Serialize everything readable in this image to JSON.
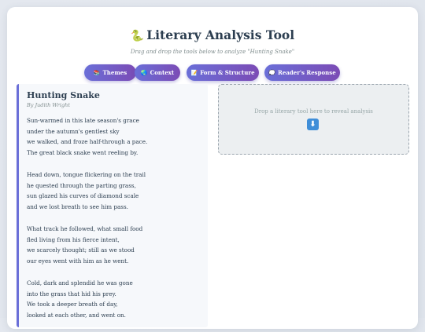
{
  "header": {
    "title": "Literary Analysis Tool",
    "subtitle": "Drag and drop the tools below to analyze \"Hunting Snake\""
  },
  "tools": [
    {
      "label": "Themes",
      "icon": "book-icon"
    },
    {
      "label": "Context",
      "icon": "globe-icon"
    },
    {
      "label": "Form & Structure",
      "icon": "memo-icon"
    },
    {
      "label": "Reader's Response",
      "icon": "speech-bubble-icon"
    }
  ],
  "poem": {
    "title": "Hunting Snake",
    "author": "By Judith Wright",
    "stanzas": [
      [
        "Sun-warmed in this late season's grace",
        "under the autumn's gentlest sky",
        "we walked, and froze half-through a pace.",
        "The great black snake went reeling by."
      ],
      [
        "Head down, tongue flickering on the trail",
        "he quested through the parting grass,",
        "sun glazed his curves of diamond scale",
        "and we lost breath to see him pass."
      ],
      [
        "What track he followed, what small food",
        "fled living from his fierce intent,",
        "we scarcely thought; still as we stood",
        "our eyes went with him as he went."
      ],
      [
        "Cold, dark and splendid he was gone",
        "into the grass that hid his prey.",
        "We took a deeper breath of day,",
        "looked at each other, and went on."
      ]
    ]
  },
  "drop_zone": {
    "text": "Drop a literary tool here to reveal analysis",
    "icon": "down-arrow-icon"
  },
  "colors": {
    "accent_start": "#6a6fd8",
    "accent_end": "#7b4bb5",
    "title": "#2c3e50"
  }
}
